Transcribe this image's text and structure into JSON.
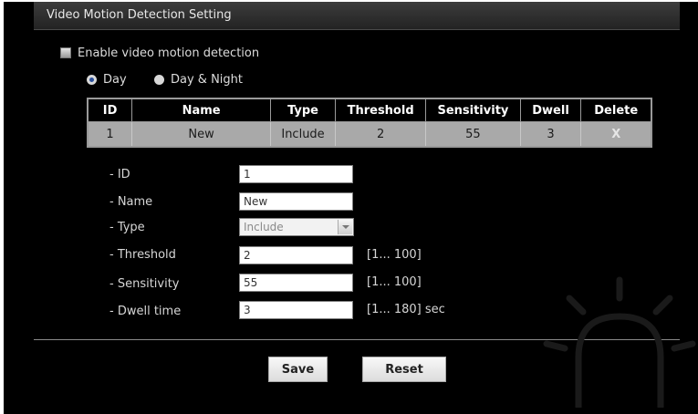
{
  "panel": {
    "title": "Video Motion Detection Setting"
  },
  "enable": {
    "label": "Enable video motion detection",
    "checked": false
  },
  "mode": {
    "options": [
      {
        "label": "Day",
        "selected": true
      },
      {
        "label": "Day & Night",
        "selected": false
      }
    ]
  },
  "table": {
    "headers": [
      "ID",
      "Name",
      "Type",
      "Threshold",
      "Sensitivity",
      "Dwell",
      "Delete"
    ],
    "rows": [
      {
        "id": "1",
        "name": "New",
        "type": "Include",
        "threshold": "2",
        "sensitivity": "55",
        "dwell": "3",
        "delete": "X"
      }
    ]
  },
  "form": {
    "id": {
      "label": "- ID",
      "value": "1"
    },
    "name": {
      "label": "- Name",
      "value": "New"
    },
    "type": {
      "label": "- Type",
      "value": "Include"
    },
    "threshold": {
      "label": "- Threshold",
      "value": "2",
      "range": "[1... 100]"
    },
    "sensitivity": {
      "label": "- Sensitivity",
      "value": "55",
      "range": "[1... 100]"
    },
    "dwell": {
      "label": "- Dwell time",
      "value": "3",
      "range": "[1... 180] sec"
    }
  },
  "buttons": {
    "save": "Save",
    "reset": "Reset"
  },
  "colors": {
    "background": "#000000",
    "row": "#a9a9a9",
    "header": "#2e2e2e"
  },
  "icons": {
    "watermark": "alarm-light-icon",
    "select_arrow": "chevron-down-icon"
  }
}
